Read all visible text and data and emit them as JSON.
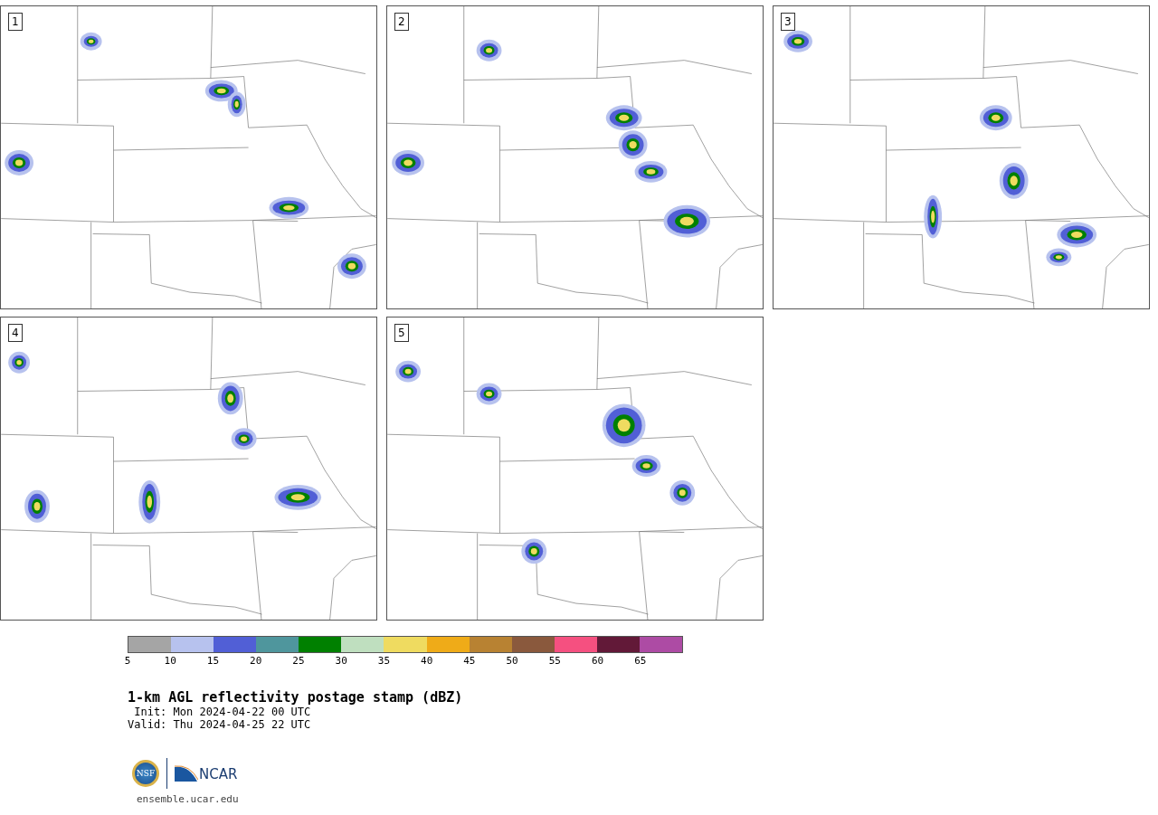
{
  "panels": [
    {
      "label": "1"
    },
    {
      "label": "2"
    },
    {
      "label": "3"
    },
    {
      "label": "4"
    },
    {
      "label": "5"
    }
  ],
  "colorbar": {
    "bins": [
      {
        "label": "5",
        "color": "#a5a5a5"
      },
      {
        "label": "10",
        "color": "#b7c2ee"
      },
      {
        "label": "15",
        "color": "#515fd6"
      },
      {
        "label": "20",
        "color": "#4f969d"
      },
      {
        "label": "25",
        "color": "#008000"
      },
      {
        "label": "30",
        "color": "#bfdfbf"
      },
      {
        "label": "35",
        "color": "#efdb60"
      },
      {
        "label": "40",
        "color": "#efab18"
      },
      {
        "label": "45",
        "color": "#b88232"
      },
      {
        "label": "50",
        "color": "#8a593d"
      },
      {
        "label": "55",
        "color": "#f55080"
      },
      {
        "label": "60",
        "color": "#621938"
      },
      {
        "label": "65",
        "color": "#ad4ba4"
      }
    ]
  },
  "title": "1-km AGL reflectivity postage stamp (dBZ)",
  "init": "Init: Mon 2024-04-22 00 UTC",
  "valid": "Valid: Thu 2024-04-25 22 UTC",
  "logos": {
    "nsf": "NSF",
    "ncar": "NCAR"
  },
  "link": "ensemble.ucar.edu"
}
